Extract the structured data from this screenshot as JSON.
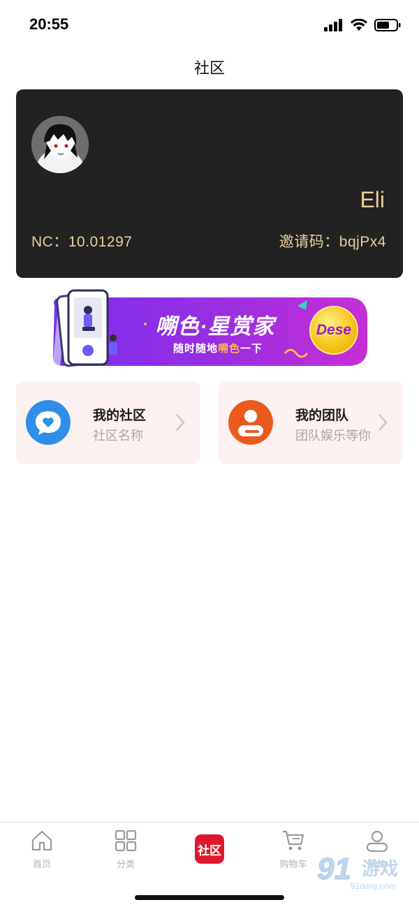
{
  "status_bar": {
    "time": "20:55"
  },
  "header": {
    "title": "社区"
  },
  "profile": {
    "name": "Eli",
    "nc_label": "NC：",
    "nc_value": "10.01297",
    "invite_label": "邀请码：",
    "invite_code": "bqjPx4"
  },
  "banner": {
    "title": "嗍色·星赏家",
    "subtitle_prefix": "随时随地",
    "subtitle_highlight": "嗍色",
    "subtitle_suffix": "一下",
    "coin_text": "Dese"
  },
  "features": [
    {
      "title": "我的社区",
      "subtitle": "社区名称",
      "icon": "chat-heart-icon",
      "color": "#2f8fe8"
    },
    {
      "title": "我的团队",
      "subtitle": "团队娱乐等你",
      "icon": "person-icon",
      "color": "#ea5a1c"
    }
  ],
  "tabs": [
    {
      "label": "首页",
      "icon": "home-icon"
    },
    {
      "label": "分类",
      "icon": "grid-icon"
    },
    {
      "label": "社区",
      "icon": "community-badge",
      "active": true
    },
    {
      "label": "购物车",
      "icon": "cart-icon"
    },
    {
      "label": "我的",
      "icon": "user-icon"
    }
  ],
  "colors": {
    "accent": "#e0182d",
    "card_bg": "#222222",
    "gold_text": "#e9cf9b"
  },
  "watermark": {
    "text": "游戏",
    "domain": "91danji.com"
  }
}
